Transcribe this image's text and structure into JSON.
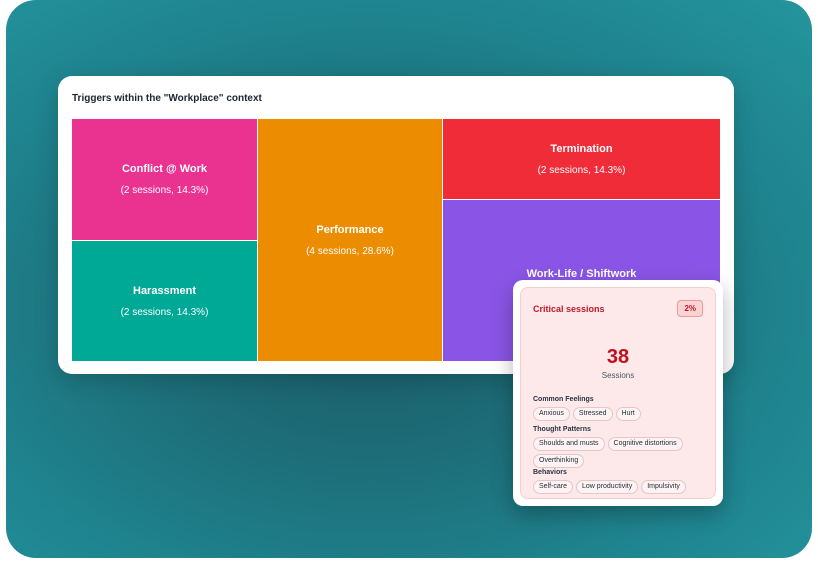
{
  "card": {
    "title": "Triggers within the \"Workplace\" context"
  },
  "treemap": [
    {
      "key": "conflict",
      "name": "Conflict @ Work",
      "detail": "(2 sessions, 14.3%)",
      "sessions": 2,
      "percent": 14.3,
      "color": "#ea3291"
    },
    {
      "key": "harassment",
      "name": "Harassment",
      "detail": "(2 sessions, 14.3%)",
      "sessions": 2,
      "percent": 14.3,
      "color": "#00a896"
    },
    {
      "key": "performance",
      "name": "Performance",
      "detail": "(4 sessions, 28.6%)",
      "sessions": 4,
      "percent": 28.6,
      "color": "#ec8c00"
    },
    {
      "key": "termination",
      "name": "Termination",
      "detail": "(2 sessions, 14.3%)",
      "sessions": 2,
      "percent": 14.3,
      "color": "#ef2c38"
    },
    {
      "key": "worklife",
      "name": "Work-Life / Shiftwork",
      "color": "#8a55e6"
    }
  ],
  "popup": {
    "title": "Critical sessions",
    "badge": "2%",
    "count": "38",
    "count_label": "Sessions",
    "groups": [
      {
        "title": "Common Feelings",
        "chips": [
          "Anxious",
          "Stressed",
          "Hurt"
        ]
      },
      {
        "title": "Thought Patterns",
        "chips": [
          "Shoulds and musts",
          "Cognitive distortions",
          "Overthinking"
        ]
      },
      {
        "title": "Behaviors",
        "chips": [
          "Self-care",
          "Low productivity",
          "Impulsivity"
        ]
      }
    ]
  },
  "colors": {
    "accent_red": "#c0182c",
    "background_teal": "#1f8590"
  }
}
